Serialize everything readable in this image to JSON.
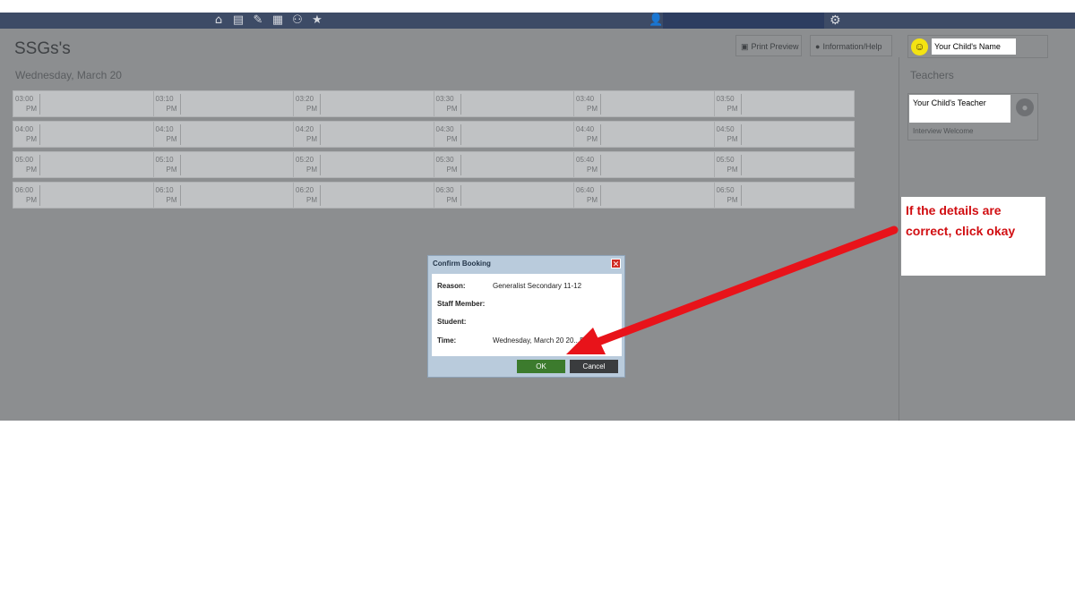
{
  "app": {
    "nav_icons": [
      "home-icon",
      "calendar-icon",
      "pencil-icon",
      "apps-grid-icon",
      "people-icon",
      "star-icon"
    ],
    "nav_glyphs": [
      "⌂",
      "▤",
      "✎",
      "▦",
      "⚇",
      "★"
    ],
    "user_icon": "👤",
    "gear_icon": "⚙"
  },
  "page": {
    "title": "SSGs's",
    "date": "Wednesday, March 20"
  },
  "toolbar": {
    "print_label": "Print Preview",
    "info_label": "Information/Help",
    "child_name": "Your Child's Name"
  },
  "sidebar": {
    "heading": "Teachers",
    "teacher_name": "Your Child's Teacher",
    "teacher_status": "Interview Welcome"
  },
  "slots": [
    [
      "03:00",
      "03:10",
      "03:20",
      "03:30",
      "03:40",
      "03:50"
    ],
    [
      "04:00",
      "04:10",
      "04:20",
      "04:30",
      "04:40",
      "04:50"
    ],
    [
      "05:00",
      "05:10",
      "05:20",
      "05:30",
      "05:40",
      "05:50"
    ],
    [
      "06:00",
      "06:10",
      "06:20",
      "06:30",
      "06:40",
      "06:50"
    ]
  ],
  "slot_suffix": "PM",
  "dialog": {
    "title": "Confirm Booking",
    "close": "✕",
    "reason_label": "Reason:",
    "reason_value": "Generalist Secondary 11-12",
    "staff_label": "Staff Member:",
    "student_label": "Student:",
    "time_label": "Time:",
    "time_value": "Wednesday, March 20 20...PM",
    "ok_label": "OK",
    "cancel_label": "Cancel"
  },
  "callout": {
    "text": "If the details are correct, click okay",
    "color": "#d10e12"
  }
}
